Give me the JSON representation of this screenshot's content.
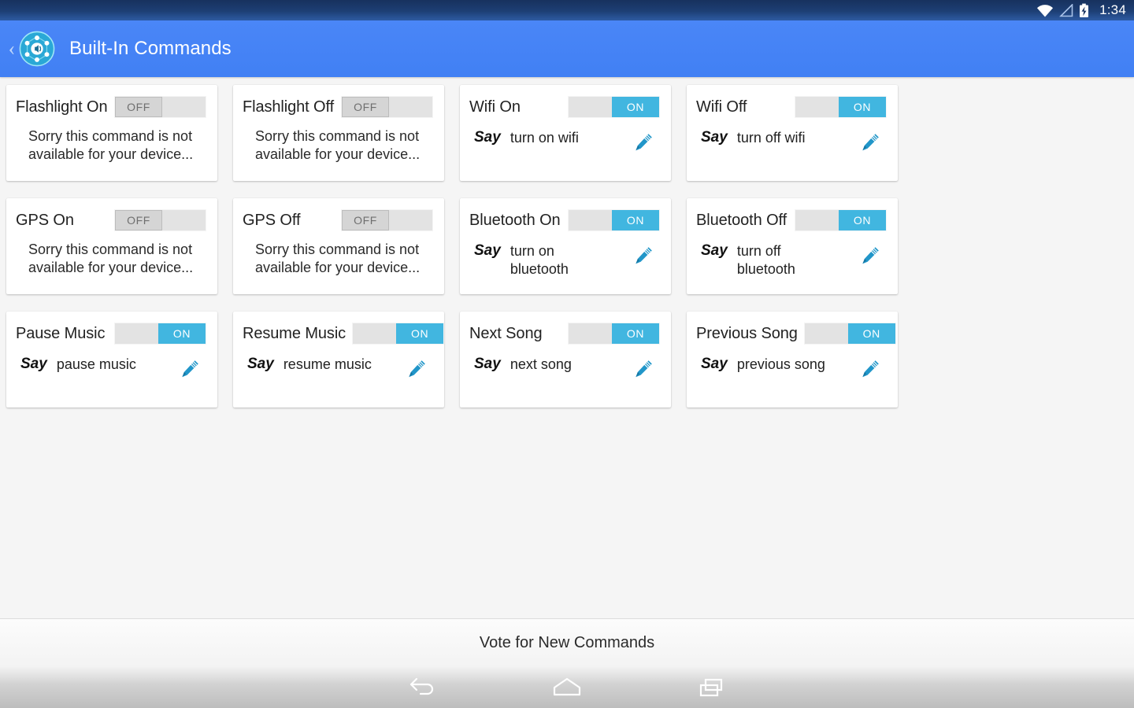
{
  "status_bar": {
    "time": "1:34",
    "icons": [
      "wifi-icon",
      "signal-icon",
      "battery-charging-icon"
    ]
  },
  "action_bar": {
    "back_icon": "back-chevron-icon",
    "app_icon": "app-logo-icon",
    "title": "Built-In Commands"
  },
  "colors": {
    "accent_blue": "#4180f4",
    "toggle_on": "#41b6e0",
    "pencil": "#2196c9",
    "status_bar": "#17315e",
    "page_background": "#f5f5f5",
    "card_background": "#ffffff"
  },
  "labels": {
    "say": "Say",
    "toggle_on": "ON",
    "toggle_off": "OFF",
    "unavailable": "Sorry this command is not available for your device...",
    "edit_icon": "edit-pencil-icon"
  },
  "cards": [
    {
      "title": "Flashlight On",
      "state": "OFF",
      "available": false,
      "phrase": ""
    },
    {
      "title": "Flashlight Off",
      "state": "OFF",
      "available": false,
      "phrase": ""
    },
    {
      "title": "Wifi On",
      "state": "ON",
      "available": true,
      "phrase": "turn on wifi"
    },
    {
      "title": "Wifi Off",
      "state": "ON",
      "available": true,
      "phrase": "turn off wifi"
    },
    {
      "title": "GPS On",
      "state": "OFF",
      "available": false,
      "phrase": ""
    },
    {
      "title": "GPS Off",
      "state": "OFF",
      "available": false,
      "phrase": ""
    },
    {
      "title": "Bluetooth On",
      "state": "ON",
      "available": true,
      "phrase": "turn on bluetooth"
    },
    {
      "title": "Bluetooth Off",
      "state": "ON",
      "available": true,
      "phrase": "turn off bluetooth"
    },
    {
      "title": "Pause Music",
      "state": "ON",
      "available": true,
      "phrase": "pause music"
    },
    {
      "title": "Resume Music",
      "state": "ON",
      "available": true,
      "phrase": "resume music"
    },
    {
      "title": "Next Song",
      "state": "ON",
      "available": true,
      "phrase": "next song"
    },
    {
      "title": "Previous Song",
      "state": "ON",
      "available": true,
      "phrase": "previous song"
    }
  ],
  "footer": {
    "vote_label": "Vote for New Commands"
  },
  "nav_bar": {
    "back": "nav-back-icon",
    "home": "nav-home-icon",
    "recents": "nav-recents-icon"
  }
}
